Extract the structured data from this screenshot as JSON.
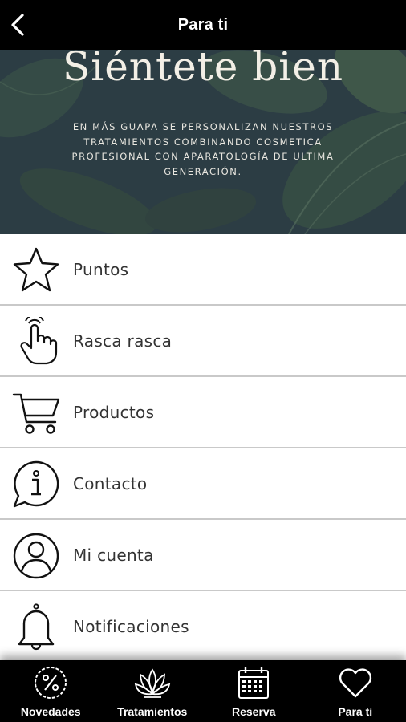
{
  "header": {
    "title": "Para ti"
  },
  "banner": {
    "headline": "Siéntete bien",
    "tagline": "EN MÁS GUAPA SE PERSONALIZAN NUESTROS TRATAMIENTOS COMBINANDO COSMETICA PROFESIONAL CON APARATOLOGÍA DE ULTIMA GENERACIÓN."
  },
  "menu": [
    {
      "label": "Puntos",
      "icon": "star-icon"
    },
    {
      "label": "Rasca rasca",
      "icon": "pointing-hand-icon"
    },
    {
      "label": "Productos",
      "icon": "shopping-cart-icon"
    },
    {
      "label": "Contacto",
      "icon": "info-bubble-icon"
    },
    {
      "label": "Mi cuenta",
      "icon": "user-circle-icon"
    },
    {
      "label": "Notificaciones",
      "icon": "bell-icon"
    }
  ],
  "tabs": [
    {
      "label": "Novedades",
      "icon": "discount-badge-icon"
    },
    {
      "label": "Tratamientos",
      "icon": "lotus-icon"
    },
    {
      "label": "Reserva",
      "icon": "calendar-icon"
    },
    {
      "label": "Para ti",
      "icon": "heart-icon"
    }
  ],
  "colors": {
    "header_bg": "#000000",
    "banner_bg": "#2b3a40",
    "divider": "#c9c9c9",
    "text": "#333333"
  }
}
